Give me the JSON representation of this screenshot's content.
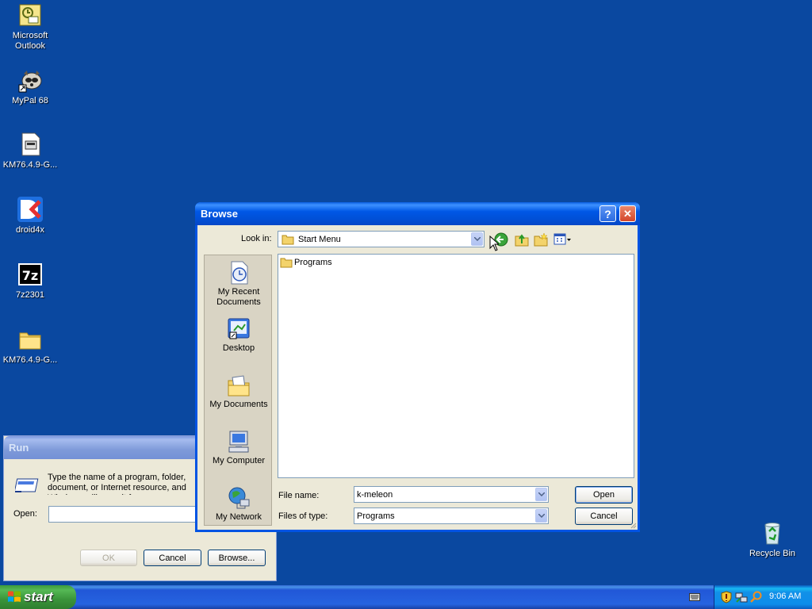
{
  "desktop": {
    "icons": [
      {
        "label": "Microsoft Outlook",
        "icon": "outlook-icon"
      },
      {
        "label": "MyPal 68",
        "icon": "mypal-icon"
      },
      {
        "label": "KM76.4.9-G...",
        "icon": "installer-icon"
      },
      {
        "label": "droid4x",
        "icon": "droid4x-icon"
      },
      {
        "label": "7z2301",
        "icon": "7zip-icon"
      },
      {
        "label": "KM76.4.9-G...",
        "icon": "folder-icon"
      },
      {
        "label": "Recycle Bin",
        "icon": "recycle-bin-icon"
      }
    ]
  },
  "run_dialog": {
    "title": "Run",
    "description": "Type the name of a program, folder, document, or Internet resource, and Windows will open it for you.",
    "open_label": "Open:",
    "open_value": "",
    "ok_label": "OK",
    "cancel_label": "Cancel",
    "browse_label": "Browse..."
  },
  "browse_dialog": {
    "title": "Browse",
    "help_label": "?",
    "close_label": "✕",
    "look_in_label": "Look in:",
    "look_in_value": "Start Menu",
    "toolbar_icons": [
      "back-icon",
      "up-folder-icon",
      "new-folder-icon",
      "view-menu-icon"
    ],
    "places": [
      {
        "label": "My Recent Documents",
        "icon": "recent-documents-icon"
      },
      {
        "label": "Desktop",
        "icon": "desktop-icon"
      },
      {
        "label": "My Documents",
        "icon": "my-documents-icon"
      },
      {
        "label": "My Computer",
        "icon": "my-computer-icon"
      },
      {
        "label": "My Network",
        "icon": "my-network-icon"
      }
    ],
    "files": [
      {
        "name": "Programs",
        "icon": "folder-icon"
      }
    ],
    "file_name_label": "File name:",
    "file_name_value": "k-meleon",
    "files_of_type_label": "Files of type:",
    "files_of_type_value": "Programs",
    "open_button": "Open",
    "cancel_button": "Cancel"
  },
  "taskbar": {
    "start_label": "start",
    "clock": "9:06 AM",
    "tray_icons": [
      "keyboard-icon",
      "security-shield-icon",
      "network-icon",
      "search-icon"
    ]
  },
  "colors": {
    "desktop": "#0a48a0",
    "title_active": "#0058e6",
    "dialog_face": "#ece9d8",
    "start_green": "#3c9a3c"
  }
}
